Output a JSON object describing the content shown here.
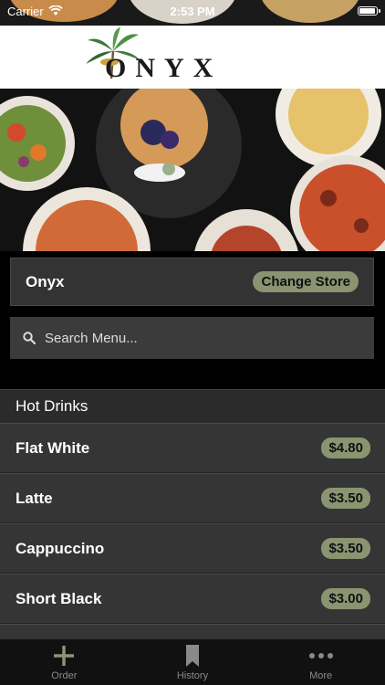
{
  "status_bar": {
    "carrier": "Carrier",
    "time": "2:53 PM"
  },
  "brand": {
    "logo_text": "ONYX"
  },
  "store": {
    "name": "Onyx",
    "change_label": "Change Store"
  },
  "search": {
    "placeholder": "Search Menu..."
  },
  "section": {
    "title": "Hot Drinks"
  },
  "menu": {
    "items": [
      {
        "name": "Flat White",
        "price": "$4.80"
      },
      {
        "name": "Latte",
        "price": "$3.50"
      },
      {
        "name": "Cappuccino",
        "price": "$3.50"
      },
      {
        "name": "Short Black",
        "price": "$3.00"
      }
    ]
  },
  "tabbar": {
    "tabs": [
      {
        "label": "Order",
        "icon": "plus-icon"
      },
      {
        "label": "History",
        "icon": "bookmark-icon"
      },
      {
        "label": "More",
        "icon": "ellipsis-icon"
      }
    ]
  },
  "colors": {
    "accent": "#8a9471",
    "background": "#000000",
    "card": "#353535"
  }
}
